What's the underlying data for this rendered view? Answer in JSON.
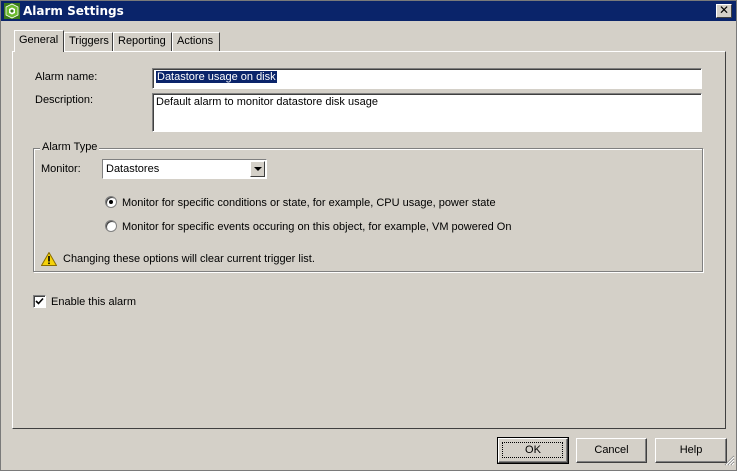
{
  "window": {
    "title": "Alarm Settings",
    "close_glyph": "✕"
  },
  "tabs": [
    {
      "label": "General",
      "active": true
    },
    {
      "label": "Triggers",
      "active": false
    },
    {
      "label": "Reporting",
      "active": false
    },
    {
      "label": "Actions",
      "active": false
    }
  ],
  "general": {
    "alarm_name_label": "Alarm name:",
    "alarm_name_value": "Datastore usage on disk",
    "description_label": "Description:",
    "description_value": "Default alarm to monitor datastore disk usage",
    "alarm_type": {
      "title": "Alarm Type",
      "monitor_label": "Monitor:",
      "monitor_value": "Datastores",
      "radio_conditions_label": "Monitor for specific conditions or state, for example, CPU usage, power state",
      "radio_conditions_selected": true,
      "radio_events_label": "Monitor for specific events occuring on this object, for example, VM powered On",
      "radio_events_selected": false,
      "warning_text": "Changing these options will clear current trigger list."
    },
    "enable_label": "Enable this alarm",
    "enable_checked": true
  },
  "buttons": {
    "ok": "OK",
    "cancel": "Cancel",
    "help": "Help"
  },
  "icons": {
    "app": "vsphere-logo-icon",
    "warning": "warning-triangle-icon",
    "dropdown": "chevron-down-icon",
    "close": "close-icon"
  },
  "colors": {
    "titlebar": "#0a246a",
    "face": "#d4d0c8",
    "selection": "#0a246a",
    "warning": "#f5d20a"
  }
}
